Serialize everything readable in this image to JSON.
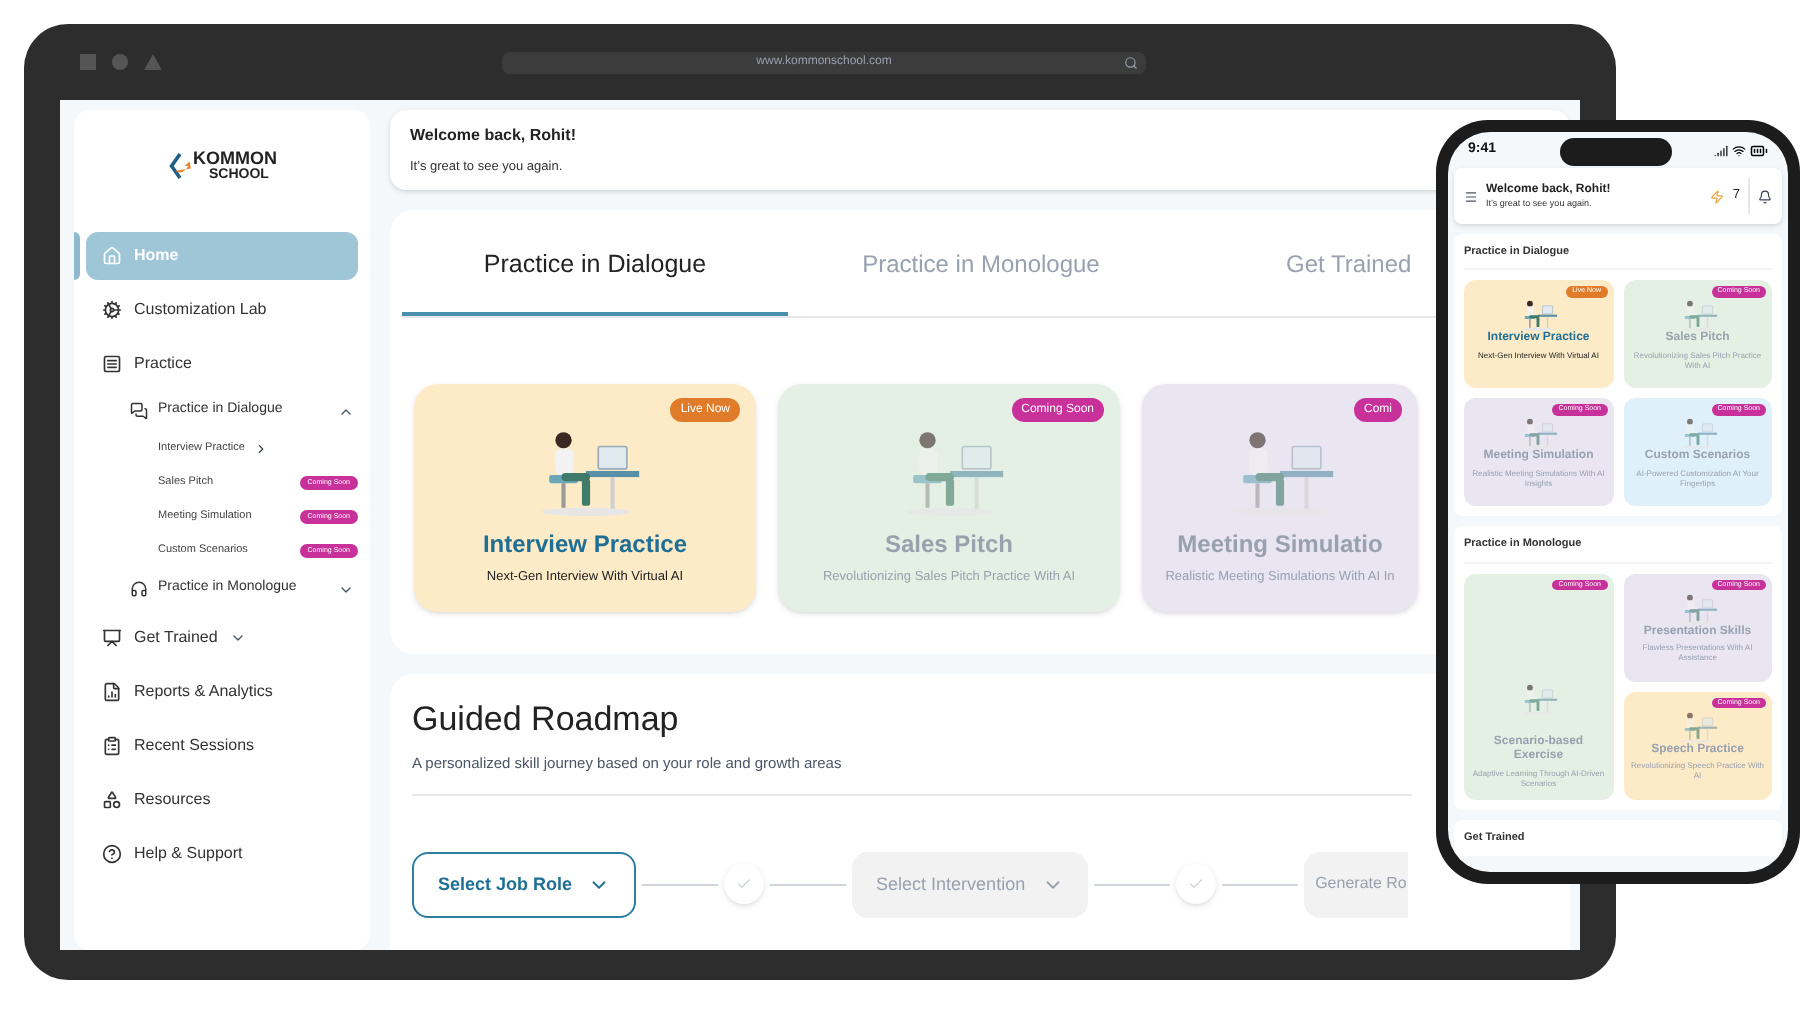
{
  "laptop": {
    "address": "www.kommonschool.com"
  },
  "sidebar": {
    "logo": {
      "top": "KOMMON",
      "bottom": "SCHOOL"
    },
    "items": [
      {
        "label": "Home",
        "selected": true
      },
      {
        "label": "Customization Lab",
        "selected": false
      },
      {
        "label": "Practice",
        "selected": false,
        "children": [
          {
            "label": "Practice in Dialogue",
            "expanded": true,
            "children": [
              {
                "label": "Interview Practice"
              },
              {
                "label": "Sales Pitch",
                "badge": {
                  "text": "Coming Soon",
                  "color": "#c8309a"
                }
              },
              {
                "label": "Meeting Simulation",
                "badge": {
                  "text": "Coming Soon",
                  "color": "#c8309a"
                }
              },
              {
                "label": "Custom Scenarios",
                "badge": {
                  "text": "Coming Soon",
                  "color": "#c8309a"
                }
              }
            ]
          },
          {
            "label": "Practice in Monologue",
            "expanded": false
          }
        ]
      },
      {
        "label": "Get Trained",
        "selected": false,
        "expanded": false
      },
      {
        "label": "Reports & Analytics",
        "selected": false
      },
      {
        "label": "Recent Sessions",
        "selected": false
      },
      {
        "label": "Resources",
        "selected": false
      },
      {
        "label": "Help & Support",
        "selected": false
      }
    ]
  },
  "welcome": {
    "title": "Welcome back, Rohit!",
    "subtitle": "It’s great to see you again."
  },
  "tabs": [
    {
      "label": "Practice in Dialogue",
      "selected": true
    },
    {
      "label": "Practice in Monologue",
      "selected": false
    },
    {
      "label": "Get Trained",
      "selected": false
    }
  ],
  "cards": [
    {
      "title": "Interview Practice",
      "subtitle": "Next-Gen Interview With Virtual AI",
      "badge": {
        "text": "Live Now",
        "color": "#e07b2a"
      },
      "color": "#fdebc8",
      "disabled": false
    },
    {
      "title": "Sales Pitch",
      "subtitle": "Revolutionizing Sales Pitch Practice With AI",
      "badge": {
        "text": "Coming Soon",
        "color": "#c8309a"
      },
      "color": "#e4f0e4",
      "disabled": true
    },
    {
      "title": "Meeting Simulatio",
      "subtitle": "Realistic Meeting Simulations With AI In",
      "badge": {
        "text": "Comi",
        "color": "#c8309a"
      },
      "color": "#e9e5f1",
      "disabled": true
    }
  ],
  "roadmap": {
    "title": "Guided Roadmap",
    "subtitle": "A personalized skill journey based on your role and growth areas",
    "steps": [
      {
        "kind": "dropdown",
        "label": "Select Job Role",
        "disabled": false
      },
      {
        "kind": "check"
      },
      {
        "kind": "dropdown",
        "label": "Select Intervention",
        "disabled": true
      },
      {
        "kind": "check"
      },
      {
        "kind": "button",
        "label": "Generate Ro",
        "disabled": true
      }
    ]
  },
  "phone": {
    "time": "9:41",
    "title": "Welcome back, Rohit!",
    "subtitle": "It’s great to see you again.",
    "streak": "7",
    "sections": [
      {
        "title": "Practice in Dialogue",
        "cards": [
          {
            "title": "Interview Practice",
            "subtitle": "Next-Gen Interview With Virtual AI",
            "badge": {
              "text": "Live Now",
              "color": "#e07b2a"
            },
            "color": "#fdebc8",
            "disabled": false,
            "tall": false
          },
          {
            "title": "Sales Pitch",
            "subtitle": "Revolutionizing Sales Pitch Practice With AI",
            "badge": {
              "text": "Coming Soon",
              "color": "#c8309a"
            },
            "color": "#e4f0e4",
            "disabled": true,
            "tall": false
          },
          {
            "title": "Meeting Simulation",
            "subtitle": "Realistic Meeting Simulations With AI Insights",
            "badge": {
              "text": "Coming Soon",
              "color": "#c8309a"
            },
            "color": "#e9e5f1",
            "disabled": true,
            "tall": false
          },
          {
            "title": "Custom Scenarios",
            "subtitle": "AI-Powered Customization At Your Fingertips",
            "badge": {
              "text": "Coming Soon",
              "color": "#c8309a"
            },
            "color": "#dff0fb",
            "disabled": true,
            "tall": false
          }
        ]
      },
      {
        "title": "Practice in Monologue",
        "cards": [
          {
            "title": "Scenario-based Exercise",
            "subtitle": "Adaptive Learning Through AI-Driven Scenarios",
            "badge": {
              "text": "Coming Soon",
              "color": "#c8309a"
            },
            "color": "#e4f0e4",
            "disabled": true,
            "tall": true
          },
          {
            "title": "Presentation Skills",
            "subtitle": "Flawless Presentations With AI Assistance",
            "badge": {
              "text": "Coming Soon",
              "color": "#c8309a"
            },
            "color": "#e9e5f1",
            "disabled": true,
            "tall": false
          },
          {
            "title": "Speech Practice",
            "subtitle": "Revolutionizing Speech Practice With AI",
            "badge": {
              "text": "Coming Soon",
              "color": "#c8309a"
            },
            "color": "#fdebc8",
            "disabled": true,
            "tall": false
          }
        ]
      },
      {
        "title": "Get Trained"
      }
    ]
  }
}
